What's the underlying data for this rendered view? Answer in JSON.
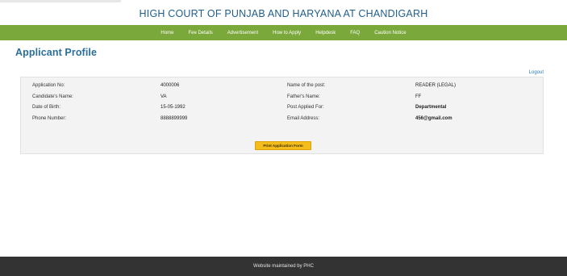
{
  "header": {
    "site_title": "HIGH COURT OF PUNJAB AND HARYANA AT CHANDIGARH"
  },
  "nav": {
    "items": [
      {
        "label": "Home"
      },
      {
        "label": "Fee Details"
      },
      {
        "label": "Advertisement"
      },
      {
        "label": "How to Apply"
      },
      {
        "label": "Helpdesk"
      },
      {
        "label": "FAQ"
      },
      {
        "label": "Caution Notice"
      }
    ]
  },
  "page": {
    "title": "Applicant Profile",
    "logout_label": "Logout"
  },
  "profile": {
    "rows": [
      {
        "label1": "Application No:",
        "value1": "4000006",
        "label2": "Name of the post:",
        "value2": "READER (LEGAL)"
      },
      {
        "label1": "Candidate's Name:",
        "value1": "VA",
        "label2": "Father's Name:",
        "value2": "FF"
      },
      {
        "label1": "Date of Birth:",
        "value1": "15-05-1992",
        "label2": "Post Applied For:",
        "value2": "Departmental"
      },
      {
        "label1": "Phone Number:",
        "value1": "8888899999",
        "label2": "Email Address:",
        "value2": "456@gmail.com"
      }
    ],
    "print_button_label": "Print Application Form"
  },
  "footer": {
    "text": "Website maintained by PHC"
  },
  "colors": {
    "nav_green": "#7aa83a",
    "title_blue": "#2a6f9b",
    "button_yellow": "#f4bd1c",
    "footer_dark": "#333333"
  }
}
